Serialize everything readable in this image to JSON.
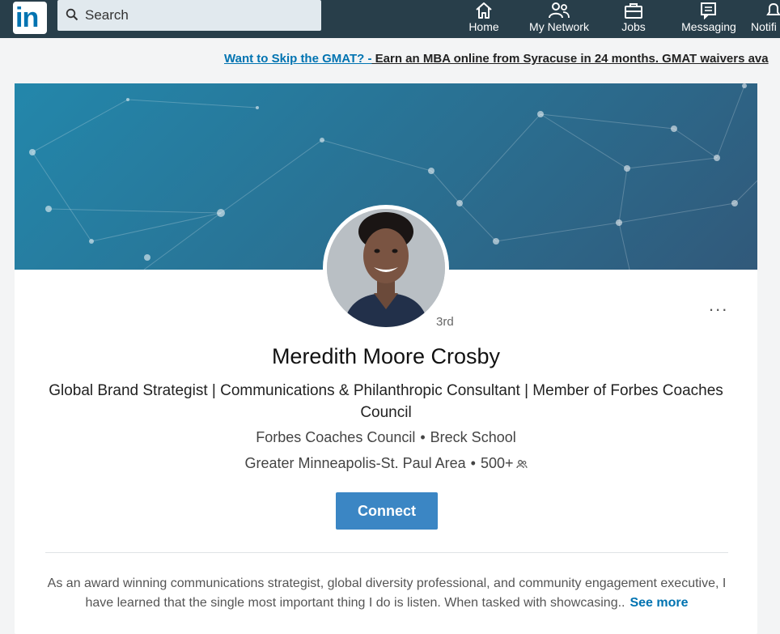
{
  "nav": {
    "logo": "in",
    "search_placeholder": "Search",
    "items": [
      {
        "label": "Home",
        "icon": "home-icon"
      },
      {
        "label": "My Network",
        "icon": "network-icon"
      },
      {
        "label": "Jobs",
        "icon": "briefcase-icon"
      },
      {
        "label": "Messaging",
        "icon": "messaging-icon"
      },
      {
        "label": "Notifi",
        "icon": "bell-icon"
      }
    ]
  },
  "ad": {
    "link": "Want to Skip the GMAT? -",
    "text": " Earn an MBA online from Syracuse in 24 months. GMAT waivers ava"
  },
  "profile": {
    "degree": "3rd",
    "name": "Meredith Moore Crosby",
    "headline": "Global Brand Strategist | Communications & Philanthropic Consultant | Member of Forbes Coaches Council",
    "company": "Forbes Coaches Council",
    "school": "Breck School",
    "location": "Greater Minneapolis-St. Paul Area",
    "connections": "500+",
    "separator": "•",
    "connect_label": "Connect",
    "more_label": "...",
    "about": "As an award winning communications strategist, global diversity professional, and community engagement executive, I have learned that the single most important thing I do is listen. When tasked with showcasing..",
    "see_more": "See more"
  },
  "colors": {
    "nav_bg": "#283e4a",
    "brand_blue": "#0073b1",
    "connect_bg": "#3b86c4"
  }
}
